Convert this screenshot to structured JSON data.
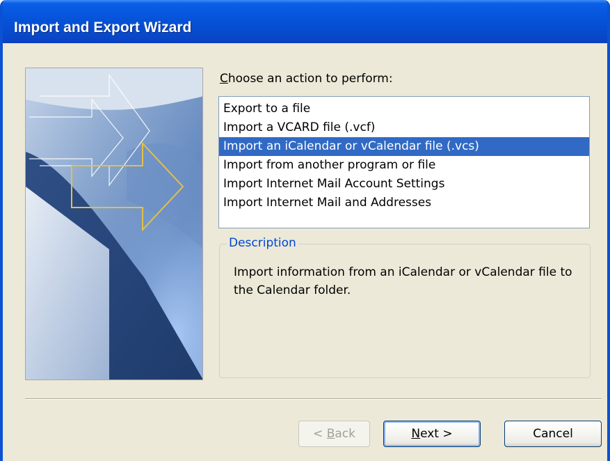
{
  "window": {
    "title": "Import and Export Wizard"
  },
  "choose": {
    "label_prefix": "C",
    "label_rest": "hoose an action to perform:"
  },
  "actions": [
    {
      "label": "Export to a file",
      "selected": false
    },
    {
      "label": "Import a VCARD file (.vcf)",
      "selected": false
    },
    {
      "label": "Import an iCalendar or vCalendar file (.vcs)",
      "selected": true
    },
    {
      "label": "Import from another program or file",
      "selected": false
    },
    {
      "label": "Import Internet Mail Account Settings",
      "selected": false
    },
    {
      "label": "Import Internet Mail and Addresses",
      "selected": false
    }
  ],
  "description": {
    "legend": "Description",
    "text": "Import information from an iCalendar or vCalendar file to the Calendar folder."
  },
  "buttons": {
    "back_prefix": "< ",
    "back_mnemonic": "B",
    "back_rest": "ack",
    "next_mnemonic": "N",
    "next_rest": "ext >",
    "cancel": "Cancel"
  },
  "colors": {
    "title_bar": "#0553d8",
    "selection": "#316ac5",
    "dialog_bg": "#ece9d8",
    "legend_text": "#0046d5"
  },
  "icons": [
    "wizard-banner-arrows-graphic"
  ]
}
